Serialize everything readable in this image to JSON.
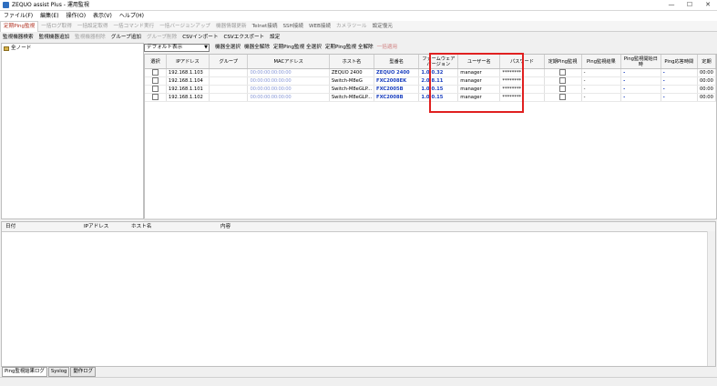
{
  "window": {
    "title": "ZEQUO assist Plus - 運用監視",
    "minimize": "—",
    "maximize": "☐",
    "close": "✕"
  },
  "menu": [
    "ファイル(F)",
    "編集(E)",
    "操作(O)",
    "表示(V)",
    "ヘルプ(H)"
  ],
  "tabs": [
    {
      "label": "定期Ping監視",
      "state": "active"
    },
    {
      "label": "一括ログ取得",
      "state": "disabled"
    },
    {
      "label": "一括設定取得",
      "state": "disabled"
    },
    {
      "label": "一括コマンド実行",
      "state": "disabled"
    },
    {
      "label": "一括バージョンアップ",
      "state": "disabled"
    },
    {
      "label": "機器情報更新",
      "state": "disabled"
    },
    {
      "label": "Telnet接続",
      "state": "enabled"
    },
    {
      "label": "SSH接続",
      "state": "enabled"
    },
    {
      "label": "WEB接続",
      "state": "enabled"
    },
    {
      "label": "カメラツール",
      "state": "disabled"
    },
    {
      "label": "設定復元",
      "state": "enabled"
    }
  ],
  "toolbar": [
    {
      "label": "監視機器検索",
      "state": "enabled"
    },
    {
      "label": "監視機器追加",
      "state": "enabled"
    },
    {
      "label": "監視機器削除",
      "state": "disabled"
    },
    {
      "label": "グループ追加",
      "state": "enabled"
    },
    {
      "label": "グループ削除",
      "state": "disabled"
    },
    {
      "label": "CSVインポート",
      "state": "enabled"
    },
    {
      "label": "CSVエクスポート",
      "state": "enabled"
    },
    {
      "label": "設定",
      "state": "enabled"
    }
  ],
  "tree": {
    "root_label": "全ノード"
  },
  "view_select": {
    "value": "デフォルト表示"
  },
  "grid_actions": [
    {
      "label": "機器全選択",
      "state": "enabled"
    },
    {
      "label": "機器全解除",
      "state": "enabled"
    },
    {
      "label": "定期Ping監視 全選択",
      "state": "enabled"
    },
    {
      "label": "定期Ping監視 全解除",
      "state": "enabled"
    },
    {
      "label": "一括適用",
      "state": "disabled"
    }
  ],
  "grid": {
    "columns": [
      "選択",
      "IPアドレス",
      "グループ",
      "MACアドレス",
      "ホスト名",
      "型番名",
      "ファームウェアバージョン",
      "ユーザー名",
      "パスワード",
      "定期Ping監視",
      "Ping監視結果",
      "Ping監視開始日時",
      "Ping応答時間",
      "定期"
    ],
    "rows": [
      {
        "ip": "192.168.1.103",
        "group": "",
        "mac": "00:00:00:00:00:00",
        "host": "ZEQUO 2400",
        "model": "ZEQUO 2400",
        "fw": "1.0.0.32",
        "user": "manager",
        "pass": "********",
        "result": "-",
        "start": "-",
        "resp": "-",
        "last": "00:00"
      },
      {
        "ip": "192.168.1.104",
        "group": "",
        "mac": "00:00:00:00:00:00",
        "host": "Switch-M8eG",
        "model": "FXC2008EK",
        "fw": "2.0.8.11",
        "user": "manager",
        "pass": "********",
        "result": "-",
        "start": "-",
        "resp": "-",
        "last": "00:00"
      },
      {
        "ip": "192.168.1.101",
        "group": "",
        "mac": "00:00:00:00:00:00",
        "host": "Switch-M8eGLP...",
        "model": "FXC2005B",
        "fw": "1.0.0.15",
        "user": "manager",
        "pass": "********",
        "result": "-",
        "start": "-",
        "resp": "-",
        "last": "00:00"
      },
      {
        "ip": "192.168.1.102",
        "group": "",
        "mac": "00:00:00:00:00:00",
        "host": "Switch-M8eGLP...",
        "model": "FXC2008B",
        "fw": "1.0.0.15",
        "user": "manager",
        "pass": "********",
        "result": "-",
        "start": "-",
        "resp": "-",
        "last": "00:00"
      }
    ]
  },
  "log": {
    "columns": [
      "日付",
      "IPアドレス",
      "ホスト名",
      "内容"
    ]
  },
  "bottom_tabs": [
    "Ping監視結果ログ",
    "Syslog",
    "動作ログ"
  ],
  "colors": {
    "highlight": "#e02020",
    "active_tab_text": "#b03020",
    "link_blue": "#1a3fbf"
  }
}
